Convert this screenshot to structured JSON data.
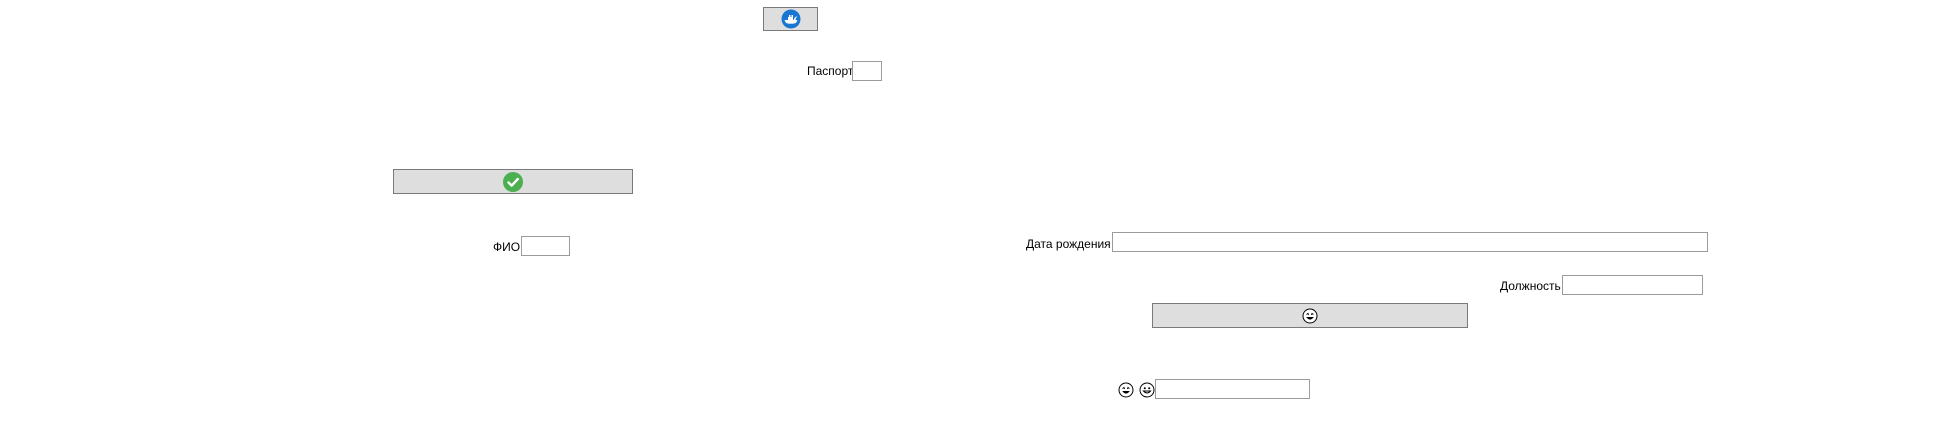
{
  "top_button": {
    "icon": "whale-ship-icon",
    "icon_color": "#1976d2"
  },
  "passport": {
    "label": "Паспорт",
    "value": ""
  },
  "confirm_button": {
    "icon": "check-circle-icon",
    "icon_color": "#4caf50"
  },
  "fio": {
    "label": "ФИО",
    "value": ""
  },
  "birth_date": {
    "label": "Дата рождения",
    "value": ""
  },
  "position": {
    "label": "Должность",
    "value": ""
  },
  "emoji_button": {
    "icon": "laughing-face-icon"
  },
  "emoji_row": {
    "icons": [
      "laughing-face-icon",
      "grinning-face-icon"
    ],
    "value": ""
  }
}
